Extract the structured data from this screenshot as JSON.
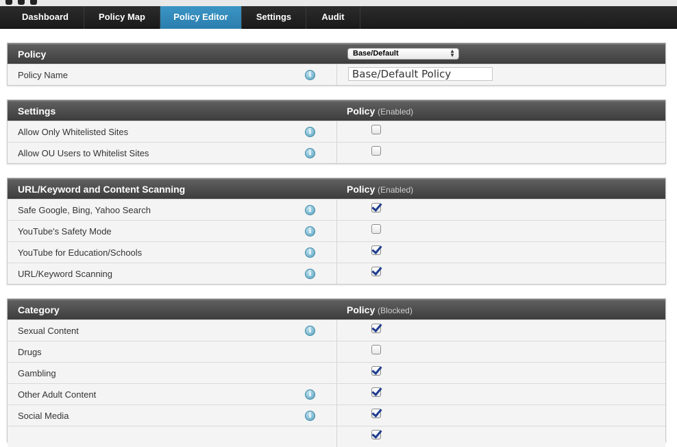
{
  "nav": {
    "tabs": [
      {
        "label": "Dashboard"
      },
      {
        "label": "Policy Map"
      },
      {
        "label": "Policy Editor"
      },
      {
        "label": "Settings"
      },
      {
        "label": "Audit"
      }
    ]
  },
  "policy_panel": {
    "title": "Policy",
    "select_value": "Base/Default",
    "name_label": "Policy Name",
    "name_value": "Base/Default Policy"
  },
  "settings_panel": {
    "title": "Settings",
    "policy_label": "Policy",
    "policy_sub": "(Enabled)",
    "rows": [
      {
        "label": "Allow Only Whitelisted Sites",
        "checked": false
      },
      {
        "label": "Allow OU Users to Whitelist Sites",
        "checked": false
      }
    ]
  },
  "scanning_panel": {
    "title": "URL/Keyword and Content Scanning",
    "policy_label": "Policy",
    "policy_sub": "(Enabled)",
    "rows": [
      {
        "label": "Safe Google, Bing, Yahoo Search",
        "checked": true
      },
      {
        "label": "YouTube's Safety Mode",
        "checked": false
      },
      {
        "label": "YouTube for Education/Schools",
        "checked": true
      },
      {
        "label": "URL/Keyword Scanning",
        "checked": true
      }
    ]
  },
  "category_panel": {
    "title": "Category",
    "policy_label": "Policy",
    "policy_sub": "(Blocked)",
    "rows": [
      {
        "label": "Sexual Content",
        "checked": true
      },
      {
        "label": "Drugs",
        "checked": false
      },
      {
        "label": "Gambling",
        "checked": true
      },
      {
        "label": "Other Adult Content",
        "checked": true
      },
      {
        "label": "Social Media",
        "checked": true
      }
    ]
  },
  "icons": {
    "info": "info-icon"
  },
  "colors": {
    "active_tab": "#2f86b8",
    "checkmark": "#1d3c8f",
    "header": "#4a4a4a"
  }
}
